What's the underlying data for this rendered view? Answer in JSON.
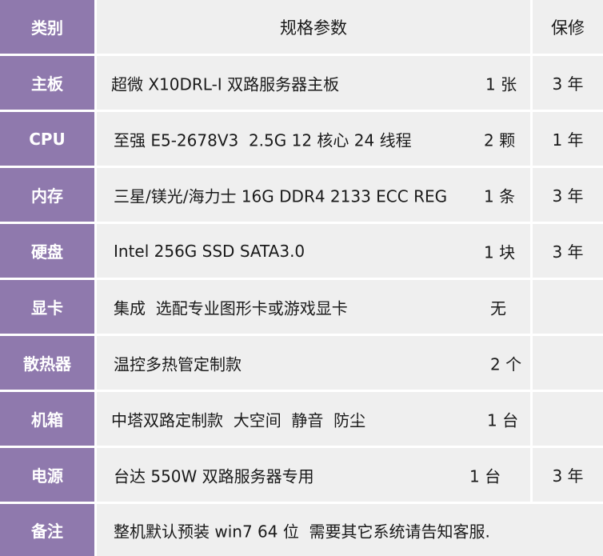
{
  "header": {
    "category": "类别",
    "spec": "规格参数",
    "warranty": "保修"
  },
  "rows": [
    {
      "category": "主板",
      "spec": "超微 X10DRL-I 双路服务器主板",
      "qty": "1 张",
      "warranty": "3 年"
    },
    {
      "category": "CPU",
      "spec": "至强 E5-2678V3  2.5G 12 核心 24 线程",
      "qty": "2 颗",
      "warranty": "1 年"
    },
    {
      "category": "内存",
      "spec": "三星/镁光/海力士 16G DDR4 2133 ECC REG",
      "qty": "1 条",
      "warranty": "3 年"
    },
    {
      "category": "硬盘",
      "spec": "Intel 256G SSD SATA3.0",
      "qty": "1 块",
      "warranty": "3 年"
    },
    {
      "category": "显卡",
      "spec": "集成  选配专业图形卡或游戏显卡",
      "qty": "无",
      "warranty": ""
    },
    {
      "category": "散热器",
      "spec": "温控多热管定制款",
      "qty": "2 个",
      "warranty": ""
    },
    {
      "category": "机箱",
      "spec": "中塔双路定制款  大空间  静音  防尘",
      "qty": "1 台",
      "warranty": ""
    },
    {
      "category": "电源",
      "spec": "台达 550W 双路服务器专用",
      "qty": "1 台",
      "warranty": "3 年"
    },
    {
      "category": "备注",
      "spec": "整机默认预装 win7 64 位  需要其它系统请告知客服.",
      "qty": "",
      "warranty": ""
    }
  ]
}
